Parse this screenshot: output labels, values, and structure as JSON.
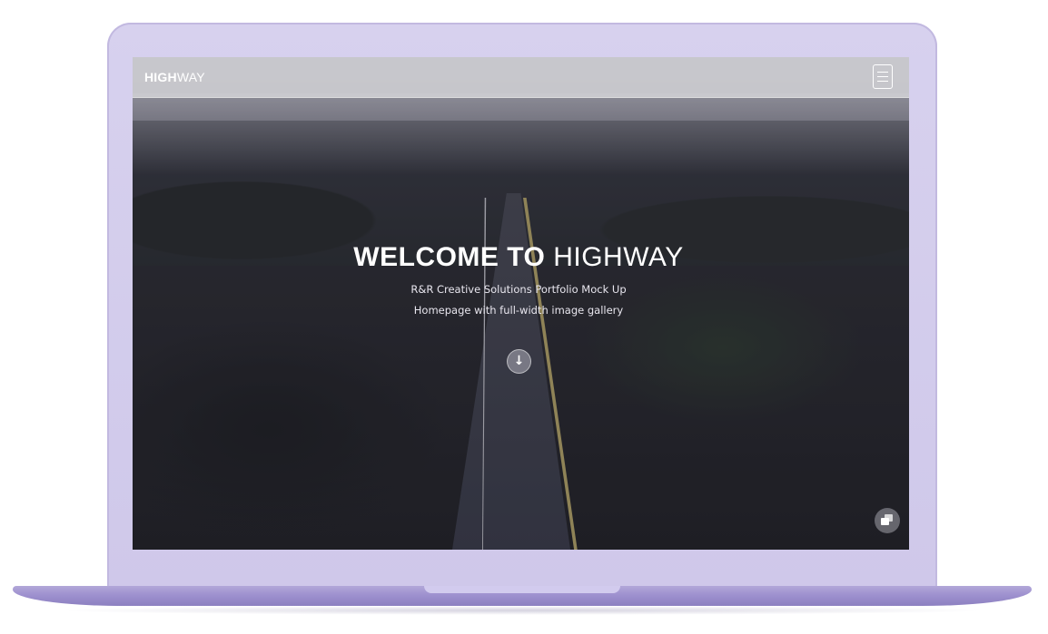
{
  "navbar": {
    "brand_bold": "HIGH",
    "brand_light": "WAY",
    "menu_icon": "hamburger-menu-icon"
  },
  "hero": {
    "title_bold": "WELCOME TO",
    "title_light": "HIGHWAY",
    "subtitle_1": "R&R Creative Solutions Portfolio Mock Up",
    "subtitle_2": "Homepage with full-width image gallery",
    "scroll_icon": "arrow-down-icon",
    "scroll_glyph": "↓"
  },
  "gallery_icon": "gallery-icon",
  "colors": {
    "laptop": "#d2cbee",
    "navbar": "#cdcdd2",
    "text": "#ffffff"
  }
}
